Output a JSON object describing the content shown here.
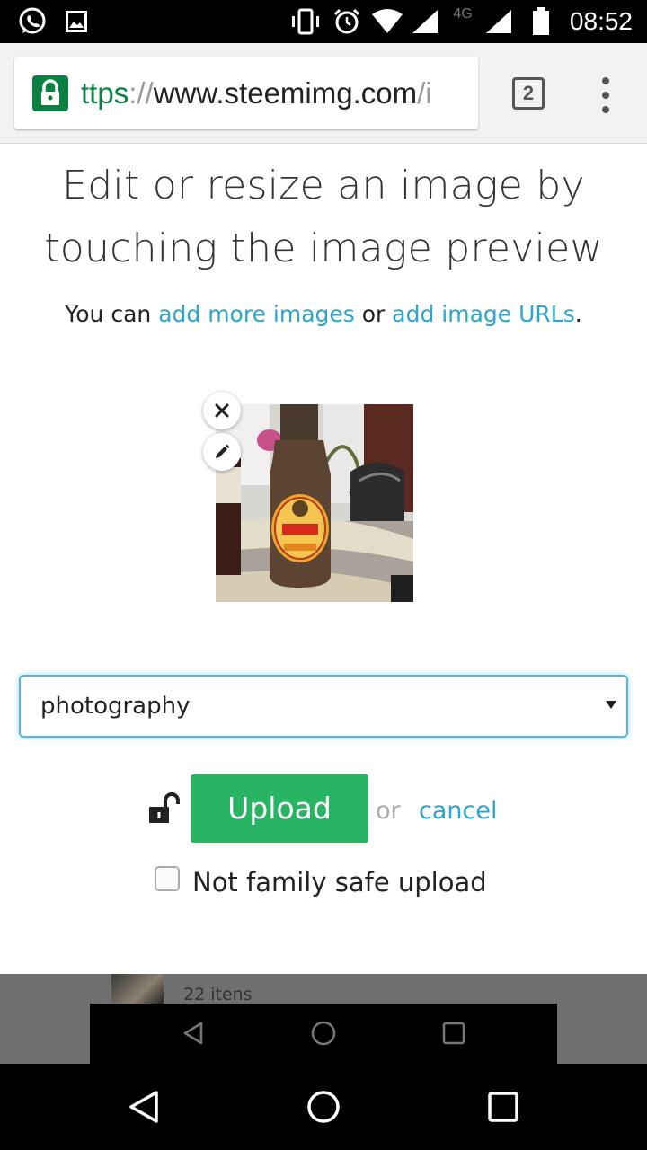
{
  "status_bar": {
    "time": "08:52",
    "network_type": "4G",
    "icons": [
      "whatsapp-icon",
      "image-icon",
      "vibrate-icon",
      "alarm-icon",
      "wifi-icon",
      "signal-icon",
      "signal-icon",
      "battery-icon"
    ]
  },
  "browser": {
    "url_scheme": "ttps",
    "url_separator": "://",
    "url_host": "www.steemimg.com",
    "url_path": "/i",
    "tab_count": "2",
    "secure_color": "#0b8043"
  },
  "page": {
    "heading_line1": "Edit or resize an image by",
    "heading_line2": "touching the image preview",
    "sub_prefix": "You can ",
    "sub_link1": "add more images",
    "sub_middle": " or ",
    "sub_link2": "add image URLs",
    "sub_suffix": ".",
    "link_color": "#2ca5cf",
    "category_select": "photography",
    "upload_label": "Upload",
    "upload_color": "#28b463",
    "or_label": "or",
    "cancel_label": "cancel",
    "nsfw_label": "Not family safe upload",
    "nsfw_checked": false,
    "behind_text": "22 itens"
  }
}
